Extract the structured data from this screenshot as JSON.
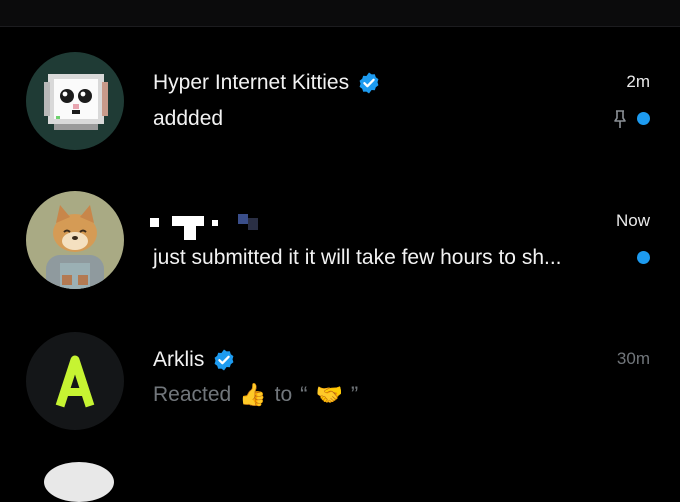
{
  "conversations": [
    {
      "name": "Hyper Internet Kitties",
      "verified": true,
      "time": "2m",
      "preview": "addded",
      "pinned": true,
      "unread": true,
      "avatar_icon": "pixel-computer-cat-icon"
    },
    {
      "name": "",
      "verified": false,
      "time": "Now",
      "preview": "just submitted it it will take few hours to sh...",
      "pinned": false,
      "unread": true,
      "avatar_icon": "shiba-dog-icon"
    },
    {
      "name": "Arklis",
      "verified": true,
      "time": "30m",
      "preview_prefix": "Reacted",
      "preview_reaction": "👍",
      "preview_mid": "to",
      "preview_open_quote": "“",
      "preview_emoji": "🤝",
      "preview_close_quote": "”",
      "unread": false,
      "avatar_icon": "arklis-a-logo-icon"
    }
  ],
  "colors": {
    "accent": "#1d9bf0",
    "background": "#000000",
    "secondary_text": "#71767b",
    "arklis_logo": "#c6f432"
  }
}
